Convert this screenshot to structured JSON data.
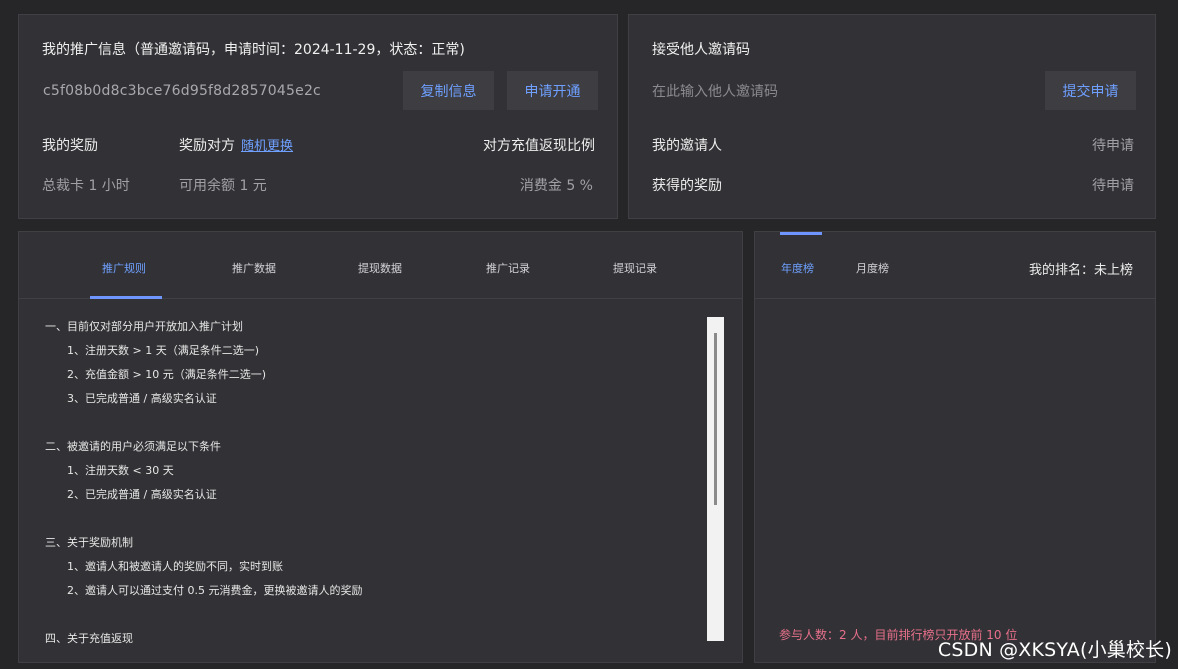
{
  "promo": {
    "title": "我的推广信息（普通邀请码，申请时间：2024-11-29，状态：正常)",
    "code": "c5f08b0d8c3bce76d95f8d2857045e2c",
    "copy_button": "复制信息",
    "apply_button": "申请开通",
    "reward_label": "我的奖励",
    "reward_value": "总裁卡 1 小时",
    "partner_reward_label": "奖励对方",
    "random_change_link": "随机更换",
    "partner_reward_value": "可用余额 1 元",
    "cashback_label": "对方充值返现比例",
    "cashback_value": "消费金 5 %"
  },
  "accept": {
    "title": "接受他人邀请码",
    "input_placeholder": "在此输入他人邀请码",
    "submit_button": "提交申请",
    "inviter_label": "我的邀请人",
    "inviter_value": "待申请",
    "reward_label": "获得的奖励",
    "reward_value": "待申请"
  },
  "rules": {
    "tabs": [
      "推广规则",
      "推广数据",
      "提现数据",
      "推广记录",
      "提现记录"
    ],
    "active_tab": 0,
    "sections": [
      {
        "heading": "一、目前仅对部分用户开放加入推广计划",
        "items": [
          "1、注册天数 > 1 天（满足条件二选一)",
          "2、充值金额 > 10 元（满足条件二选一)",
          "3、已完成普通 / 高级实名认证"
        ]
      },
      {
        "heading": "二、被邀请的用户必须满足以下条件",
        "items": [
          "1、注册天数 < 30 天",
          "2、已完成普通 / 高级实名认证"
        ]
      },
      {
        "heading": "三、关于奖励机制",
        "items": [
          "1、邀请人和被邀请人的奖励不同，实时到账",
          "2、邀请人可以通过支付 0.5 元消费金，更换被邀请人的奖励"
        ]
      },
      {
        "heading": "四、关于充值返现",
        "items": []
      }
    ],
    "scroll_position": 0.1
  },
  "rank": {
    "tabs": [
      "年度榜",
      "月度榜"
    ],
    "active_tab": 0,
    "my_rank": "我的排名：未上榜",
    "note": "参与人数：2 人，目前排行榜只开放前 10 位"
  },
  "watermark": "CSDN @XKSYA(小巢校长)",
  "colors": {
    "accent": "#6fa0ff",
    "note": "#e8708b",
    "panel": "#323236",
    "background": "#262629"
  }
}
